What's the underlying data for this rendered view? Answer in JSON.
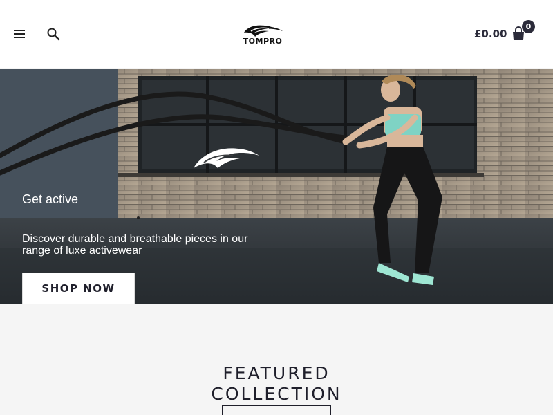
{
  "header": {
    "logo_text": "TOMPRO",
    "cart_total": "£0.00",
    "cart_count": "0",
    "icons": [
      "menu-icon",
      "search-icon",
      "shopping-bag-icon"
    ]
  },
  "hero": {
    "eyebrow": "Get active",
    "subtitle": "Discover durable and breathable pieces in our range of luxe activewear",
    "cta_label": "SHOP NOW"
  },
  "featured": {
    "title_line1": "FEATURED",
    "title_line2": "COLLECTION"
  },
  "colors": {
    "text_dark": "#2b2b3a",
    "header_bg": "#ffffff",
    "page_bg": "#f5f5f5",
    "hero_text": "#ffffff"
  }
}
